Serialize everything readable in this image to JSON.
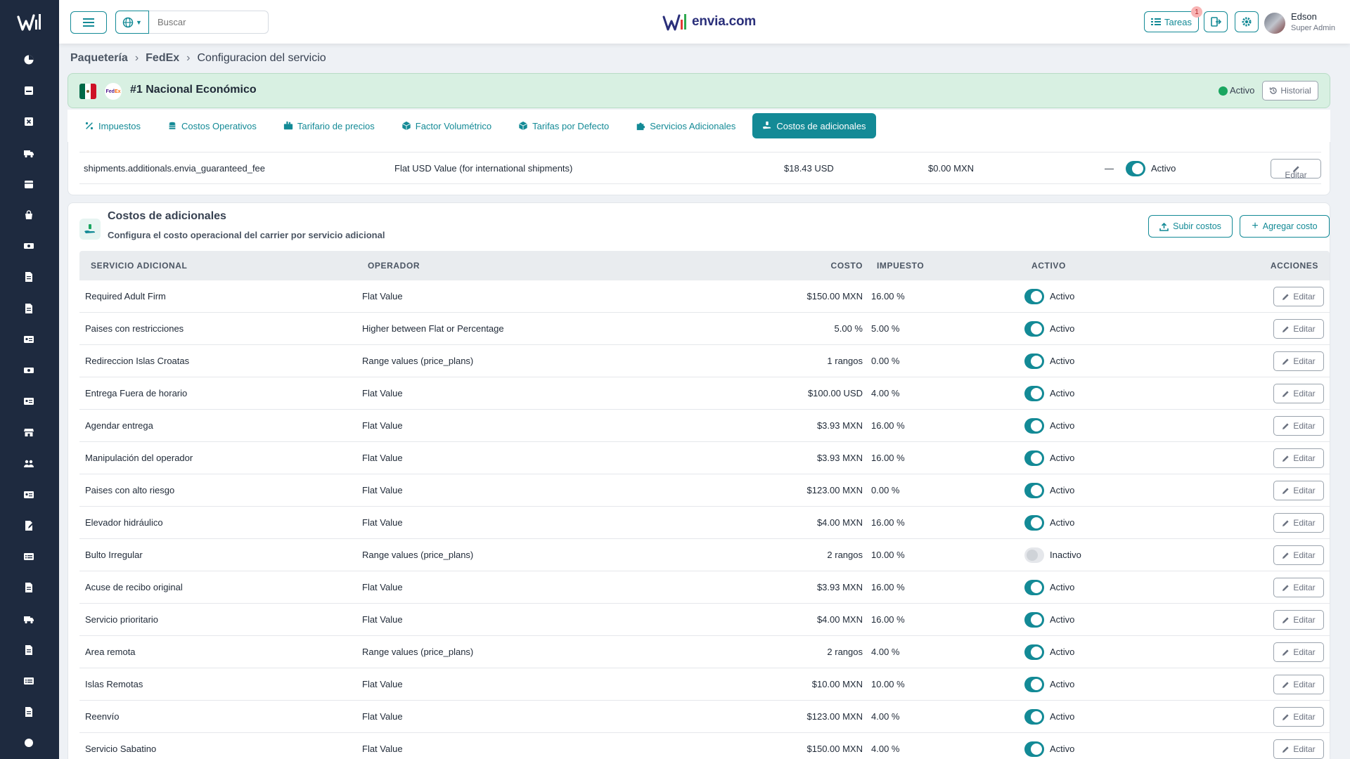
{
  "colors": {
    "accent": "#138a96",
    "sidebar": "#1e2a3f",
    "active_green": "#1aa660"
  },
  "sidebar": {
    "icons": [
      "pie-chart-icon",
      "inbox-icon",
      "close-box-icon",
      "truck-icon",
      "calendar-icon",
      "bag-icon",
      "money-icon",
      "document-icon",
      "document-icon",
      "id-card-icon",
      "money-icon",
      "id-card-icon",
      "store-icon",
      "users-icon",
      "id-card-icon",
      "edit-doc-icon",
      "list-icon",
      "document-icon",
      "truck-icon",
      "document-icon",
      "list-icon",
      "document-icon",
      "circle-icon"
    ]
  },
  "header": {
    "search_placeholder": "Buscar",
    "brand": "envia.com",
    "tasks_label": "Tareas",
    "tasks_badge": "1",
    "user_name": "Edson",
    "user_role": "Super Admin"
  },
  "breadcrumb": {
    "level1": "Paquetería",
    "level2": "FedEx",
    "level3": "Configuracion del servicio"
  },
  "service": {
    "title": "#1 Nacional Económico",
    "carrier": "FedEx",
    "status": "Activo",
    "history_label": "Historial"
  },
  "tabs": [
    {
      "label": "Impuestos",
      "icon": "percent-icon"
    },
    {
      "label": "Costos Operativos",
      "icon": "coins-icon"
    },
    {
      "label": "Tarifario de precios",
      "icon": "price-table-icon"
    },
    {
      "label": "Factor Volumétrico",
      "icon": "box-icon"
    },
    {
      "label": "Tarifas por Defecto",
      "icon": "box-icon"
    },
    {
      "label": "Servicios Adicionales",
      "icon": "puzzle-icon"
    },
    {
      "label": "Costos de adicionales",
      "icon": "hand-money-icon"
    }
  ],
  "active_tab": 6,
  "prev_row": {
    "name": "shipments.additionals.envia_guaranteed_fee",
    "operator": "Flat USD Value (for international shipments)",
    "cost": "$18.43 USD",
    "tax": "$0.00 MXN",
    "extra": "—",
    "status": "Activo",
    "edit": "Editar"
  },
  "card": {
    "title": "Costos de adicionales",
    "subtitle": "Configura el costo operacional del carrier por servicio adicional",
    "upload_label": "Subir costos",
    "add_label": "Agregar costo"
  },
  "table": {
    "headers": {
      "service": "SERVICIO ADICIONAL",
      "operator": "OPERADOR",
      "cost": "COSTO",
      "tax": "IMPUESTO",
      "active": "ACTIVO",
      "actions": "ACCIONES"
    },
    "edit_label": "Editar",
    "rows": [
      {
        "name": "Required Adult Firm",
        "operator": "Flat Value",
        "cost": "$150.00 MXN",
        "tax": "16.00 %",
        "active": true,
        "status": "Activo"
      },
      {
        "name": "Paises con restricciones",
        "operator": "Higher between Flat or Percentage",
        "cost": "5.00 %",
        "tax": "5.00 %",
        "active": true,
        "status": "Activo"
      },
      {
        "name": "Redireccion Islas Croatas",
        "operator": "Range values (price_plans)",
        "cost": "1 rangos",
        "tax": "0.00 %",
        "active": true,
        "status": "Activo"
      },
      {
        "name": "Entrega Fuera de horario",
        "operator": "Flat Value",
        "cost": "$100.00 USD",
        "tax": "4.00 %",
        "active": true,
        "status": "Activo"
      },
      {
        "name": "Agendar entrega",
        "operator": "Flat Value",
        "cost": "$3.93 MXN",
        "tax": "16.00 %",
        "active": true,
        "status": "Activo"
      },
      {
        "name": "Manipulación del operador",
        "operator": "Flat Value",
        "cost": "$3.93 MXN",
        "tax": "16.00 %",
        "active": true,
        "status": "Activo"
      },
      {
        "name": "Paises con alto riesgo",
        "operator": "Flat Value",
        "cost": "$123.00 MXN",
        "tax": "0.00 %",
        "active": true,
        "status": "Activo"
      },
      {
        "name": "Elevador hidráulico",
        "operator": "Flat Value",
        "cost": "$4.00 MXN",
        "tax": "16.00 %",
        "active": true,
        "status": "Activo"
      },
      {
        "name": "Bulto Irregular",
        "operator": "Range values (price_plans)",
        "cost": "2 rangos",
        "tax": "10.00 %",
        "active": false,
        "status": "Inactivo"
      },
      {
        "name": "Acuse de recibo original",
        "operator": "Flat Value",
        "cost": "$3.93 MXN",
        "tax": "16.00 %",
        "active": true,
        "status": "Activo"
      },
      {
        "name": "Servicio prioritario",
        "operator": "Flat Value",
        "cost": "$4.00 MXN",
        "tax": "16.00 %",
        "active": true,
        "status": "Activo"
      },
      {
        "name": "Area remota",
        "operator": "Range values (price_plans)",
        "cost": "2 rangos",
        "tax": "4.00 %",
        "active": true,
        "status": "Activo"
      },
      {
        "name": "Islas Remotas",
        "operator": "Flat Value",
        "cost": "$10.00 MXN",
        "tax": "10.00 %",
        "active": true,
        "status": "Activo"
      },
      {
        "name": "Reenvío",
        "operator": "Flat Value",
        "cost": "$123.00 MXN",
        "tax": "4.00 %",
        "active": true,
        "status": "Activo"
      },
      {
        "name": "Servicio Sabatino",
        "operator": "Flat Value",
        "cost": "$150.00 MXN",
        "tax": "4.00 %",
        "active": true,
        "status": "Activo"
      }
    ]
  }
}
